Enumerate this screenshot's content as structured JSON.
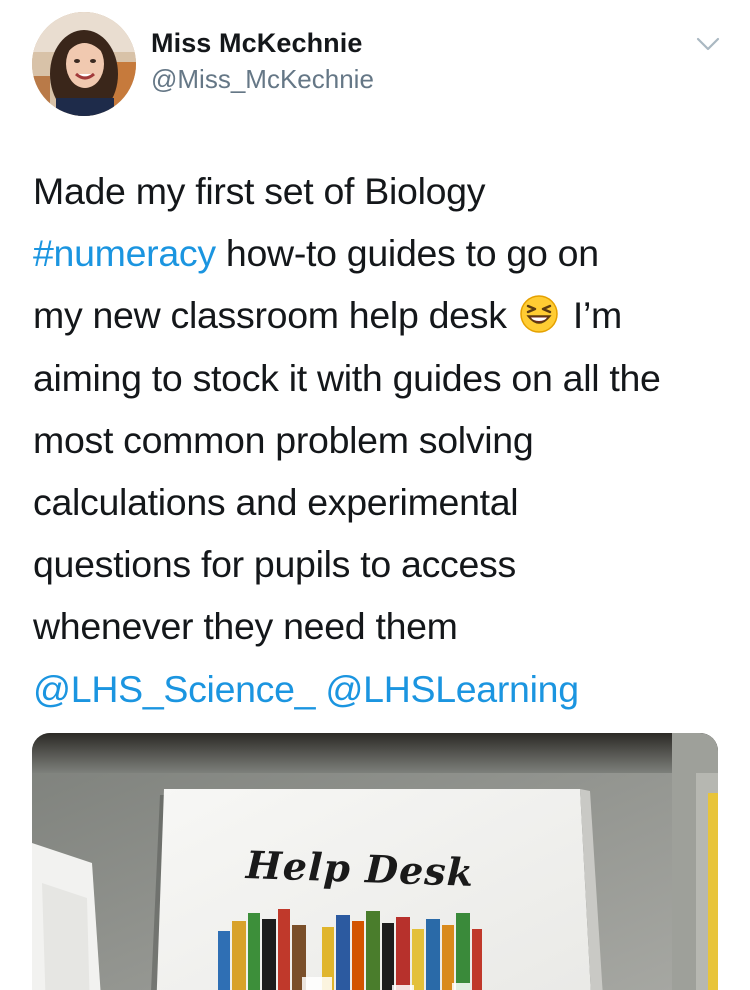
{
  "author": {
    "name": "Miss McKechnie",
    "handle": "@Miss_McKechnie"
  },
  "icons": {
    "caret": "chevron-down-icon",
    "emoji": "grinning-squinting-face-emoji"
  },
  "tweet": {
    "lines": [
      [
        {
          "t": "Made my first set of Biology"
        }
      ],
      [
        {
          "t": "#numeracy",
          "link": true
        },
        {
          "t": " how-to guides to go on"
        }
      ],
      [
        {
          "t": "my new classroom help desk "
        },
        {
          "emoji": true
        },
        {
          "t": " I’m"
        }
      ],
      [
        {
          "t": "aiming to stock it with guides on all the"
        }
      ],
      [
        {
          "t": "most common problem solving"
        }
      ],
      [
        {
          "t": "calculations and experimental"
        }
      ],
      [
        {
          "t": "questions for pupils to access"
        }
      ],
      [
        {
          "t": "whenever they need them"
        }
      ],
      [
        {
          "t": "@LHS_Science_",
          "link": true
        },
        {
          "t": " "
        },
        {
          "t": "@LHSLearning",
          "link": true
        }
      ]
    ]
  },
  "photo": {
    "sign_text": "Help Desk"
  },
  "colors": {
    "link": "#1b95e0",
    "handle": "#657786",
    "text": "#14171a"
  }
}
